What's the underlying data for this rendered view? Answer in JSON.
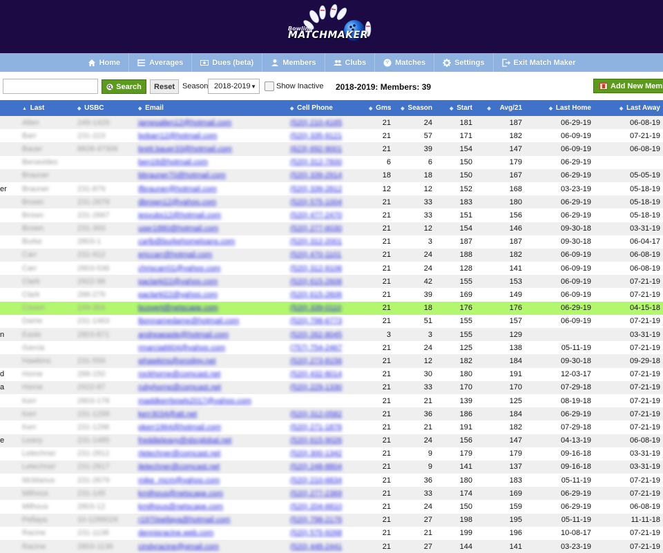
{
  "app": {
    "logo_text": "MATCHMAKER",
    "logo_sub": "Bowling"
  },
  "nav": [
    {
      "label": "Home",
      "icon": "home-icon"
    },
    {
      "label": "Averages",
      "icon": "list-icon"
    },
    {
      "label": "Dues (beta)",
      "icon": "money-icon"
    },
    {
      "label": "Members",
      "icon": "user-icon"
    },
    {
      "label": "Clubs",
      "icon": "users-icon"
    },
    {
      "label": "Matches",
      "icon": "bowling-ball-icon"
    },
    {
      "label": "Settings",
      "icon": "gear-icon"
    },
    {
      "label": "Exit Match Maker",
      "icon": "exit-icon"
    }
  ],
  "toolbar": {
    "search_value": "",
    "search_label": "Search",
    "reset_label": "Reset",
    "season_label": "Season",
    "season_value": "2018-2019",
    "show_inactive_label": "Show Inactive",
    "members_count": "2018-2019: Members: 39",
    "add_member_label": "Add New Memb"
  },
  "table": {
    "headers": {
      "last": "Last",
      "usbc": "USBC",
      "email": "Email",
      "cell": "Cell Phone",
      "gms": "Gms",
      "season": "Season",
      "start": "Start",
      "avg21": "Avg/21",
      "last_home": "Last Home",
      "last_away": "Last Away"
    },
    "rows": [
      {
        "first": "",
        "last": "Allen",
        "usbc": "249-1429",
        "email": "jamesallen12@hotmail.com",
        "cell": "(520) 210-4165",
        "gms": "21",
        "season": "24",
        "start": "181",
        "avg": "187",
        "home": "06-29-19",
        "away": "06-08-19"
      },
      {
        "first": "",
        "last": "Barr",
        "usbc": "231-223",
        "email": "bobarr12@hotmail.com",
        "cell": "(520) 335-9121",
        "gms": "21",
        "season": "57",
        "start": "171",
        "avg": "182",
        "home": "06-09-19",
        "away": "07-21-19"
      },
      {
        "first": "",
        "last": "Bauer",
        "usbc": "8828-47306",
        "email": "brett.bauer33@hotmail.com",
        "cell": "(623) 692-9001",
        "gms": "21",
        "season": "39",
        "start": "154",
        "avg": "147",
        "home": "06-09-19",
        "away": "06-08-19"
      },
      {
        "first": "",
        "last": "Benavides",
        "usbc": "",
        "email": "ben18@hotmail.com",
        "cell": "(520) 312-7600",
        "gms": "6",
        "season": "6",
        "start": "150",
        "avg": "179",
        "home": "06-29-19",
        "away": ""
      },
      {
        "first": "",
        "last": "Brauner",
        "usbc": "",
        "email": "bbrauner70@hotmail.com",
        "cell": "(520) 339-2914",
        "gms": "18",
        "season": "18",
        "start": "150",
        "avg": "167",
        "home": "06-29-19",
        "away": "05-05-19"
      },
      {
        "first": "er",
        "last": "Brauner",
        "usbc": "231-879",
        "email": "ifbrauner@hotmail.com",
        "cell": "(520) 339-2812",
        "gms": "12",
        "season": "12",
        "start": "152",
        "avg": "168",
        "home": "03-23-19",
        "away": "05-18-19"
      },
      {
        "first": "",
        "last": "Brown",
        "usbc": "231-2679",
        "email": "dbrown12@yahoo.com",
        "cell": "(520) 575-1004",
        "gms": "21",
        "season": "33",
        "start": "183",
        "avg": "180",
        "home": "06-29-19",
        "away": "05-18-19"
      },
      {
        "first": "",
        "last": "Brown",
        "usbc": "231-2667",
        "email": "jesvubs12@hotmail.com",
        "cell": "(520) 477-2470",
        "gms": "21",
        "season": "33",
        "start": "151",
        "avg": "156",
        "home": "06-29-19",
        "away": "05-18-19"
      },
      {
        "first": "",
        "last": "Brown",
        "usbc": "231-393",
        "email": "user1880@hotmail.com",
        "cell": "(520) 277-6030",
        "gms": "21",
        "season": "12",
        "start": "154",
        "avg": "146",
        "home": "09-30-18",
        "away": "03-31-19"
      },
      {
        "first": "",
        "last": "Burke",
        "usbc": "2803-1",
        "email": "carlb@burkehomeloans.com",
        "cell": "(520) 312-2001",
        "gms": "21",
        "season": "3",
        "start": "187",
        "avg": "187",
        "home": "09-30-18",
        "away": "06-04-17"
      },
      {
        "first": "",
        "last": "Carr",
        "usbc": "231-912",
        "email": "ericcarr@hotmail.com",
        "cell": "(520) 470-1101",
        "gms": "21",
        "season": "24",
        "start": "188",
        "avg": "182",
        "home": "06-09-19",
        "away": "06-08-19"
      },
      {
        "first": "",
        "last": "Carr",
        "usbc": "2803-536",
        "email": "chriscarr01@yahoo.com",
        "cell": "(520) 312-9106",
        "gms": "21",
        "season": "24",
        "start": "128",
        "avg": "141",
        "home": "06-09-19",
        "away": "06-08-19"
      },
      {
        "first": "",
        "last": "Clark",
        "usbc": "2922-98",
        "email": "paclarkl22@yahoo.com",
        "cell": "(520) 615-2606",
        "gms": "21",
        "season": "42",
        "start": "155",
        "avg": "153",
        "home": "06-09-19",
        "away": "07-21-19"
      },
      {
        "first": "",
        "last": "Clark",
        "usbc": "288-279",
        "email": "paclarkl22@yahoo.com",
        "cell": "(520) 615-2606",
        "gms": "21",
        "season": "39",
        "start": "169",
        "avg": "149",
        "home": "06-09-19",
        "away": "07-21-19"
      },
      {
        "first": "",
        "last": "Covert",
        "usbc": "249-364",
        "email": "bcovert@netscape.com",
        "cell": "(520) 339-0110",
        "gms": "21",
        "season": "18",
        "start": "176",
        "avg": "176",
        "home": "06-29-19",
        "away": "04-15-18",
        "highlight": true
      },
      {
        "first": "",
        "last": "Dame",
        "usbc": "231-1463",
        "email": "lbonnamedame@hotmail.com",
        "cell": "(520) 798-6773",
        "gms": "21",
        "season": "51",
        "start": "155",
        "avg": "157",
        "home": "06-09-19",
        "away": "07-21-19"
      },
      {
        "first": "n",
        "last": "Easle",
        "usbc": "2803-871",
        "email": "andreaeasle@hotmail.com",
        "cell": "(520) 262-8045",
        "gms": "3",
        "season": "3",
        "start": "155",
        "avg": "129",
        "home": "",
        "away": "03-31-19"
      },
      {
        "first": "",
        "last": "Garcia",
        "usbc": "",
        "email": "rmarcia6604@yahoo.com",
        "cell": "(757) 754-2467",
        "gms": "21",
        "season": "24",
        "start": "125",
        "avg": "138",
        "home": "05-11-19",
        "away": "07-21-19"
      },
      {
        "first": "",
        "last": "Hawkins",
        "usbc": "231-559",
        "email": "whawkins@prodigy.net",
        "cell": "(520) 273-8156",
        "gms": "21",
        "season": "12",
        "start": "182",
        "avg": "184",
        "home": "09-30-18",
        "away": "09-29-18"
      },
      {
        "first": "d",
        "last": "Horne",
        "usbc": "288-150",
        "email": "rockhorne@comcast.net",
        "cell": "(520) 432-8014",
        "gms": "21",
        "season": "30",
        "start": "180",
        "avg": "191",
        "home": "12-03-17",
        "away": "07-21-19"
      },
      {
        "first": "a",
        "last": "Horne",
        "usbc": "2922-87",
        "email": "rubyhorne@comcast.net",
        "cell": "(520) 229-1330",
        "gms": "21",
        "season": "33",
        "start": "170",
        "avg": "170",
        "home": "07-29-18",
        "away": "07-21-19"
      },
      {
        "first": "",
        "last": "Kerr",
        "usbc": "2803-178",
        "email": "maddkerrbowls2017@yahoo.com",
        "cell": "",
        "gms": "21",
        "season": "21",
        "start": "139",
        "avg": "125",
        "home": "08-19-18",
        "away": "07-21-19"
      },
      {
        "first": "",
        "last": "Kerr",
        "usbc": "231-1299",
        "email": "kerr3034@att.net",
        "cell": "(520) 312-0582",
        "gms": "21",
        "season": "36",
        "start": "186",
        "avg": "184",
        "home": "06-29-19",
        "away": "07-21-19"
      },
      {
        "first": "",
        "last": "Kerr",
        "usbc": "231-1296",
        "email": "pkerr1964@hotmail.com",
        "cell": "(520) 271-1876",
        "gms": "21",
        "season": "21",
        "start": "191",
        "avg": "182",
        "home": "07-29-18",
        "away": "07-21-19"
      },
      {
        "first": "e",
        "last": "Leavy",
        "usbc": "231-1485",
        "email": "freddieleavy@sbcglobal.net",
        "cell": "(520) 615-9026",
        "gms": "21",
        "season": "24",
        "start": "156",
        "avg": "147",
        "home": "04-13-19",
        "away": "06-08-19"
      },
      {
        "first": "",
        "last": "Letechner",
        "usbc": "231-2812",
        "email": "rletechner@comcast.net",
        "cell": "(520) 300-1342",
        "gms": "21",
        "season": "9",
        "start": "179",
        "avg": "179",
        "home": "09-16-18",
        "away": "03-31-19"
      },
      {
        "first": "",
        "last": "Letechner",
        "usbc": "231-2817",
        "email": "jletechner@comcast.net",
        "cell": "(520) 248-8804",
        "gms": "21",
        "season": "9",
        "start": "141",
        "avg": "137",
        "home": "09-16-18",
        "away": "03-31-19"
      },
      {
        "first": "",
        "last": "McManus",
        "usbc": "231-2679",
        "email": "mike_mcm@yahoo.com",
        "cell": "(520) 210-6834",
        "gms": "21",
        "season": "36",
        "start": "180",
        "avg": "183",
        "home": "05-11-19",
        "away": "07-21-19"
      },
      {
        "first": "",
        "last": "Milhous",
        "usbc": "231-145",
        "email": "kmilhous@netscape.com",
        "cell": "(520) 277-2369",
        "gms": "21",
        "season": "33",
        "start": "174",
        "avg": "169",
        "home": "06-29-19",
        "away": "07-21-19"
      },
      {
        "first": "",
        "last": "Milhous",
        "usbc": "2803-12",
        "email": "kmilhous@netscape.com",
        "cell": "(520) 204-6810",
        "gms": "21",
        "season": "24",
        "start": "150",
        "avg": "159",
        "home": "06-29-19",
        "away": "06-08-19"
      },
      {
        "first": "",
        "last": "Pellaya",
        "usbc": "10-1289029",
        "email": "r1970pellaya@hotmail.com",
        "cell": "(520) 798-2176",
        "gms": "21",
        "season": "27",
        "start": "198",
        "avg": "195",
        "home": "05-11-19",
        "away": "11-11-18"
      },
      {
        "first": "",
        "last": "Racine",
        "usbc": "231-1138",
        "email": "dennisracine.web.com",
        "cell": "(520) 575-9268",
        "gms": "21",
        "season": "21",
        "start": "199",
        "avg": "196",
        "home": "10-08-17",
        "away": "07-21-19"
      },
      {
        "first": "",
        "last": "Racine",
        "usbc": "2803-1136",
        "email": "cindyracine@gmail.com",
        "cell": "(520) 448-2441",
        "gms": "21",
        "season": "27",
        "start": "144",
        "avg": "141",
        "home": "03-23-19",
        "away": "07-21-19"
      }
    ]
  }
}
